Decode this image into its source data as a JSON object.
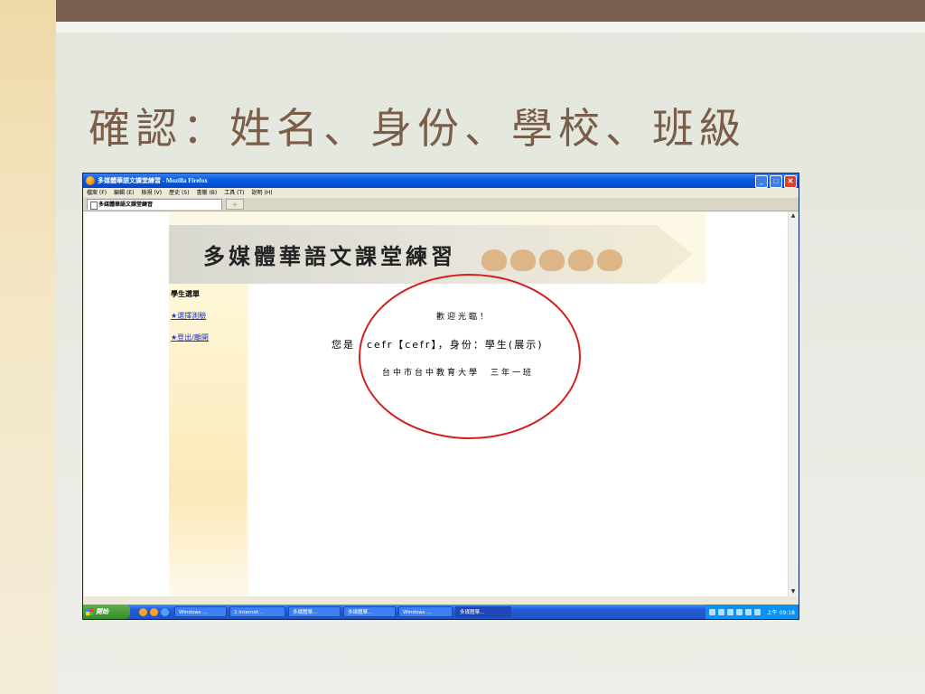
{
  "slide": {
    "title": "確認：姓名、身份、學校、班級"
  },
  "browser": {
    "window_title": "多媒體華語文課堂練習 - Mozilla Firefox",
    "menu": [
      "檔案 (F)",
      "編輯 (E)",
      "檢視 (V)",
      "歷史 (S)",
      "書籤 (B)",
      "工具 (T)",
      "說明 (H)"
    ],
    "tab_label": "多媒體華語文課堂練習",
    "new_tab": "+"
  },
  "site": {
    "title": "多媒體華語文課堂練習",
    "sidebar": {
      "heading": "學生選單",
      "links": [
        "★選擇測驗",
        "★登出/離開"
      ]
    },
    "welcome": "歡迎光臨！",
    "identity": "您是　cefr【cefr】，身份：學生(展示)",
    "school": "台中市台中教育大學　三年一班"
  },
  "taskbar": {
    "start": "開始",
    "tasks": [
      "Windows ...",
      "2 Internet...",
      "多媒體華...",
      "多媒體華...",
      "Windows ...",
      "多媒體華..."
    ],
    "clock": "上午 09:18"
  }
}
